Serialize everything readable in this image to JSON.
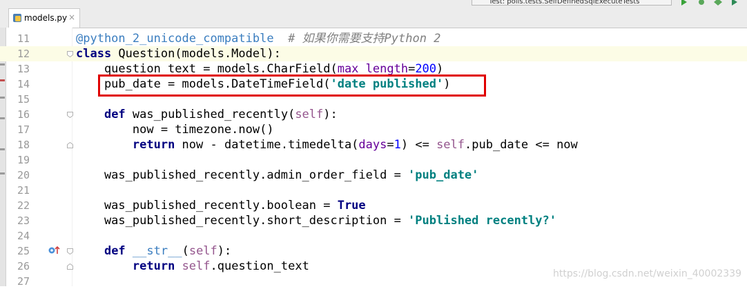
{
  "tab": {
    "title": "models.py",
    "close": "×"
  },
  "run_config": {
    "label": "Test: polls.tests.SelfDefinedSqlExecuteTests"
  },
  "code_lines": [
    {
      "n": "11",
      "html": "<span class=\"dec\">@python_2_unicode_compatible</span>  <span class=\"cmt\"># 如果你需要支持Python 2</span>"
    },
    {
      "n": "12",
      "html": "<span class=\"kw\">class</span> Question(models.Model):",
      "caret": true
    },
    {
      "n": "13",
      "html": "    question_text = models.CharField(<span class=\"param\">max_length</span>=<span class=\"num\">200</span>)"
    },
    {
      "n": "14",
      "html": "    pub_date = models.DateTimeField(<span class=\"str\">'date published'</span>)"
    },
    {
      "n": "15",
      "html": ""
    },
    {
      "n": "16",
      "html": "    <span class=\"kw\">def</span> was_published_recently(<span class=\"self\">self</span>):"
    },
    {
      "n": "17",
      "html": "        now = timezone.now()"
    },
    {
      "n": "18",
      "html": "        <span class=\"kw\">return</span> now - datetime.timedelta(<span class=\"param\">days</span>=<span class=\"num\">1</span>) &lt;= <span class=\"self\">self</span>.pub_date &lt;= now"
    },
    {
      "n": "19",
      "html": ""
    },
    {
      "n": "20",
      "html": "    was_published_recently.admin_order_field = <span class=\"str\">'pub_date'</span>"
    },
    {
      "n": "21",
      "html": ""
    },
    {
      "n": "22",
      "html": "    was_published_recently.boolean = <span class=\"kw\">True</span>"
    },
    {
      "n": "23",
      "html": "    was_published_recently.short_description = <span class=\"str\">'Published recently?'</span>"
    },
    {
      "n": "24",
      "html": ""
    },
    {
      "n": "25",
      "html": "    <span class=\"kw\">def</span> <span class=\"dec\">__str__</span>(<span class=\"self\">self</span>):"
    },
    {
      "n": "26",
      "html": "        <span class=\"kw\">return</span> <span class=\"self\">self</span>.question_text"
    },
    {
      "n": "27",
      "html": ""
    }
  ],
  "watermark": "https://blog.csdn.net/weixin_40002339",
  "colors": {
    "highlight_box": "#e00000",
    "keyword": "#000080",
    "string": "#008080"
  }
}
